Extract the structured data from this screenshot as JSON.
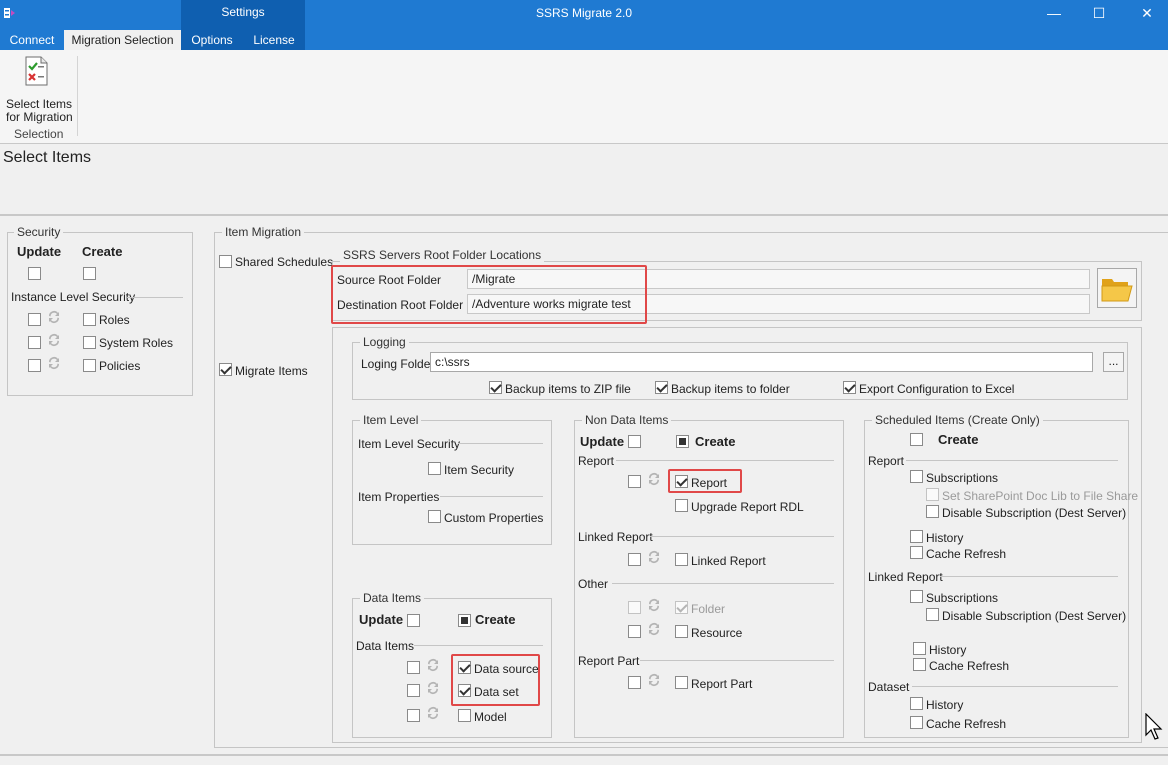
{
  "window": {
    "title": "SSRS Migrate 2.0",
    "minimize": "—",
    "maximize": "☐",
    "close": "✕"
  },
  "tabs": {
    "connect": "Connect",
    "migration_selection": "Migration Selection",
    "settings_group": "Settings",
    "options": "Options",
    "license": "License"
  },
  "ribbon": {
    "select_items_line1": "Select Items",
    "select_items_line2": "for Migration",
    "group_label": "Selection"
  },
  "page": {
    "title": "Select Items"
  },
  "security": {
    "title": "Security",
    "update": "Update",
    "create": "Create",
    "instance_level_security": "Instance Level Security",
    "roles": "Roles",
    "system_roles": "System Roles",
    "policies": "Policies"
  },
  "item_migration": {
    "title": "Item Migration",
    "shared_schedules": "Shared Schedules",
    "migrate_items": "Migrate Items",
    "root_folders": {
      "title": "SSRS Servers Root Folder Locations",
      "source_label": "Source Root Folder",
      "source_value": "/Migrate",
      "dest_label": "Destination Root Folder",
      "dest_value": "/Adventure works migrate test"
    },
    "logging": {
      "title": "Logging",
      "folder_label": "Loging Folder",
      "folder_value": "c:\\ssrs",
      "browse": "...",
      "backup_zip": "Backup items to ZIP file",
      "backup_folder": "Backup items to folder",
      "export_excel": "Export Configuration to Excel"
    },
    "item_level": {
      "title": "Item Level",
      "security_header": "Item Level Security",
      "item_security": "Item Security",
      "properties_header": "Item Properties",
      "custom_properties": "Custom Properties"
    },
    "data_items": {
      "title": "Data Items",
      "update": "Update",
      "create": "Create",
      "header": "Data Items",
      "data_source": "Data source",
      "data_set": "Data set",
      "model": "Model"
    },
    "non_data_items": {
      "title": "Non Data Items",
      "update": "Update",
      "create": "Create",
      "report_header": "Report",
      "report": "Report",
      "upgrade_rdl": "Upgrade Report RDL",
      "linked_header": "Linked Report",
      "linked_report": "Linked Report",
      "other_header": "Other",
      "folder": "Folder",
      "resource": "Resource",
      "part_header": "Report Part",
      "report_part": "Report Part"
    },
    "scheduled_items": {
      "title": "Scheduled Items (Create Only)",
      "create": "Create",
      "report_header": "Report",
      "subscriptions": "Subscriptions",
      "set_sharepoint": "Set SharePoint Doc Lib to File Share",
      "disable_sub": "Disable Subscription (Dest Server)",
      "history": "History",
      "cache_refresh": "Cache Refresh",
      "linked_header": "Linked Report",
      "linked_subscriptions": "Subscriptions",
      "linked_disable_sub": "Disable Subscription (Dest Server)",
      "linked_history": "History",
      "linked_cache_refresh": "Cache Refresh",
      "dataset_header": "Dataset",
      "dataset_history": "History",
      "dataset_cache_refresh": "Cache Refresh"
    }
  },
  "colors": {
    "titlebar": "#1f7ad2",
    "settings_group": "#0f5fb0",
    "highlight": "#e04848"
  },
  "icons": [
    "app-icon",
    "select-items-icon",
    "folder-open-icon",
    "sync-icon",
    "cursor-icon"
  ]
}
